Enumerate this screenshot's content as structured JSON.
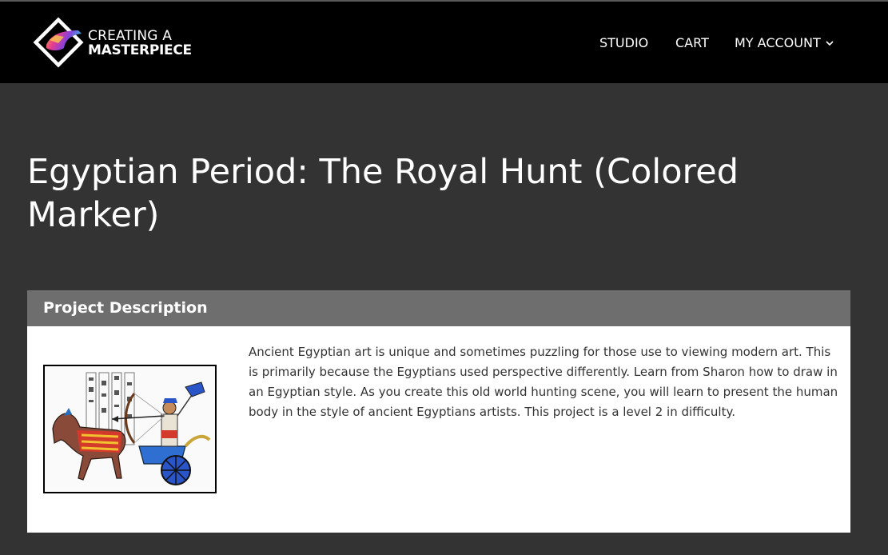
{
  "brand": {
    "line1": "CREATING A",
    "line2": "MASTERPIECE"
  },
  "nav": {
    "studio": "STUDIO",
    "cart": "CART",
    "account": "MY ACCOUNT"
  },
  "page": {
    "title": "Egyptian Period: The Royal Hunt (Colored Marker)"
  },
  "project": {
    "header": "Project Description",
    "description": "Ancient Egyptian art is unique and sometimes puzzling for those use to viewing modern art. This is primarily because the Egyptians used perspective differently. Learn from Sharon how to draw in an Egyptian style. As you create this old world hunting scene, you will learn to present the human body in the style of ancient Egyptians artists. This project is a level 2 in difficulty."
  },
  "icons": {
    "logo": "diamond-logo-icon",
    "account_dropdown": "chevron-down-icon"
  },
  "colors": {
    "header_bg": "#000000",
    "page_bg": "#333333",
    "card_header_bg": "#6e6e6e"
  }
}
